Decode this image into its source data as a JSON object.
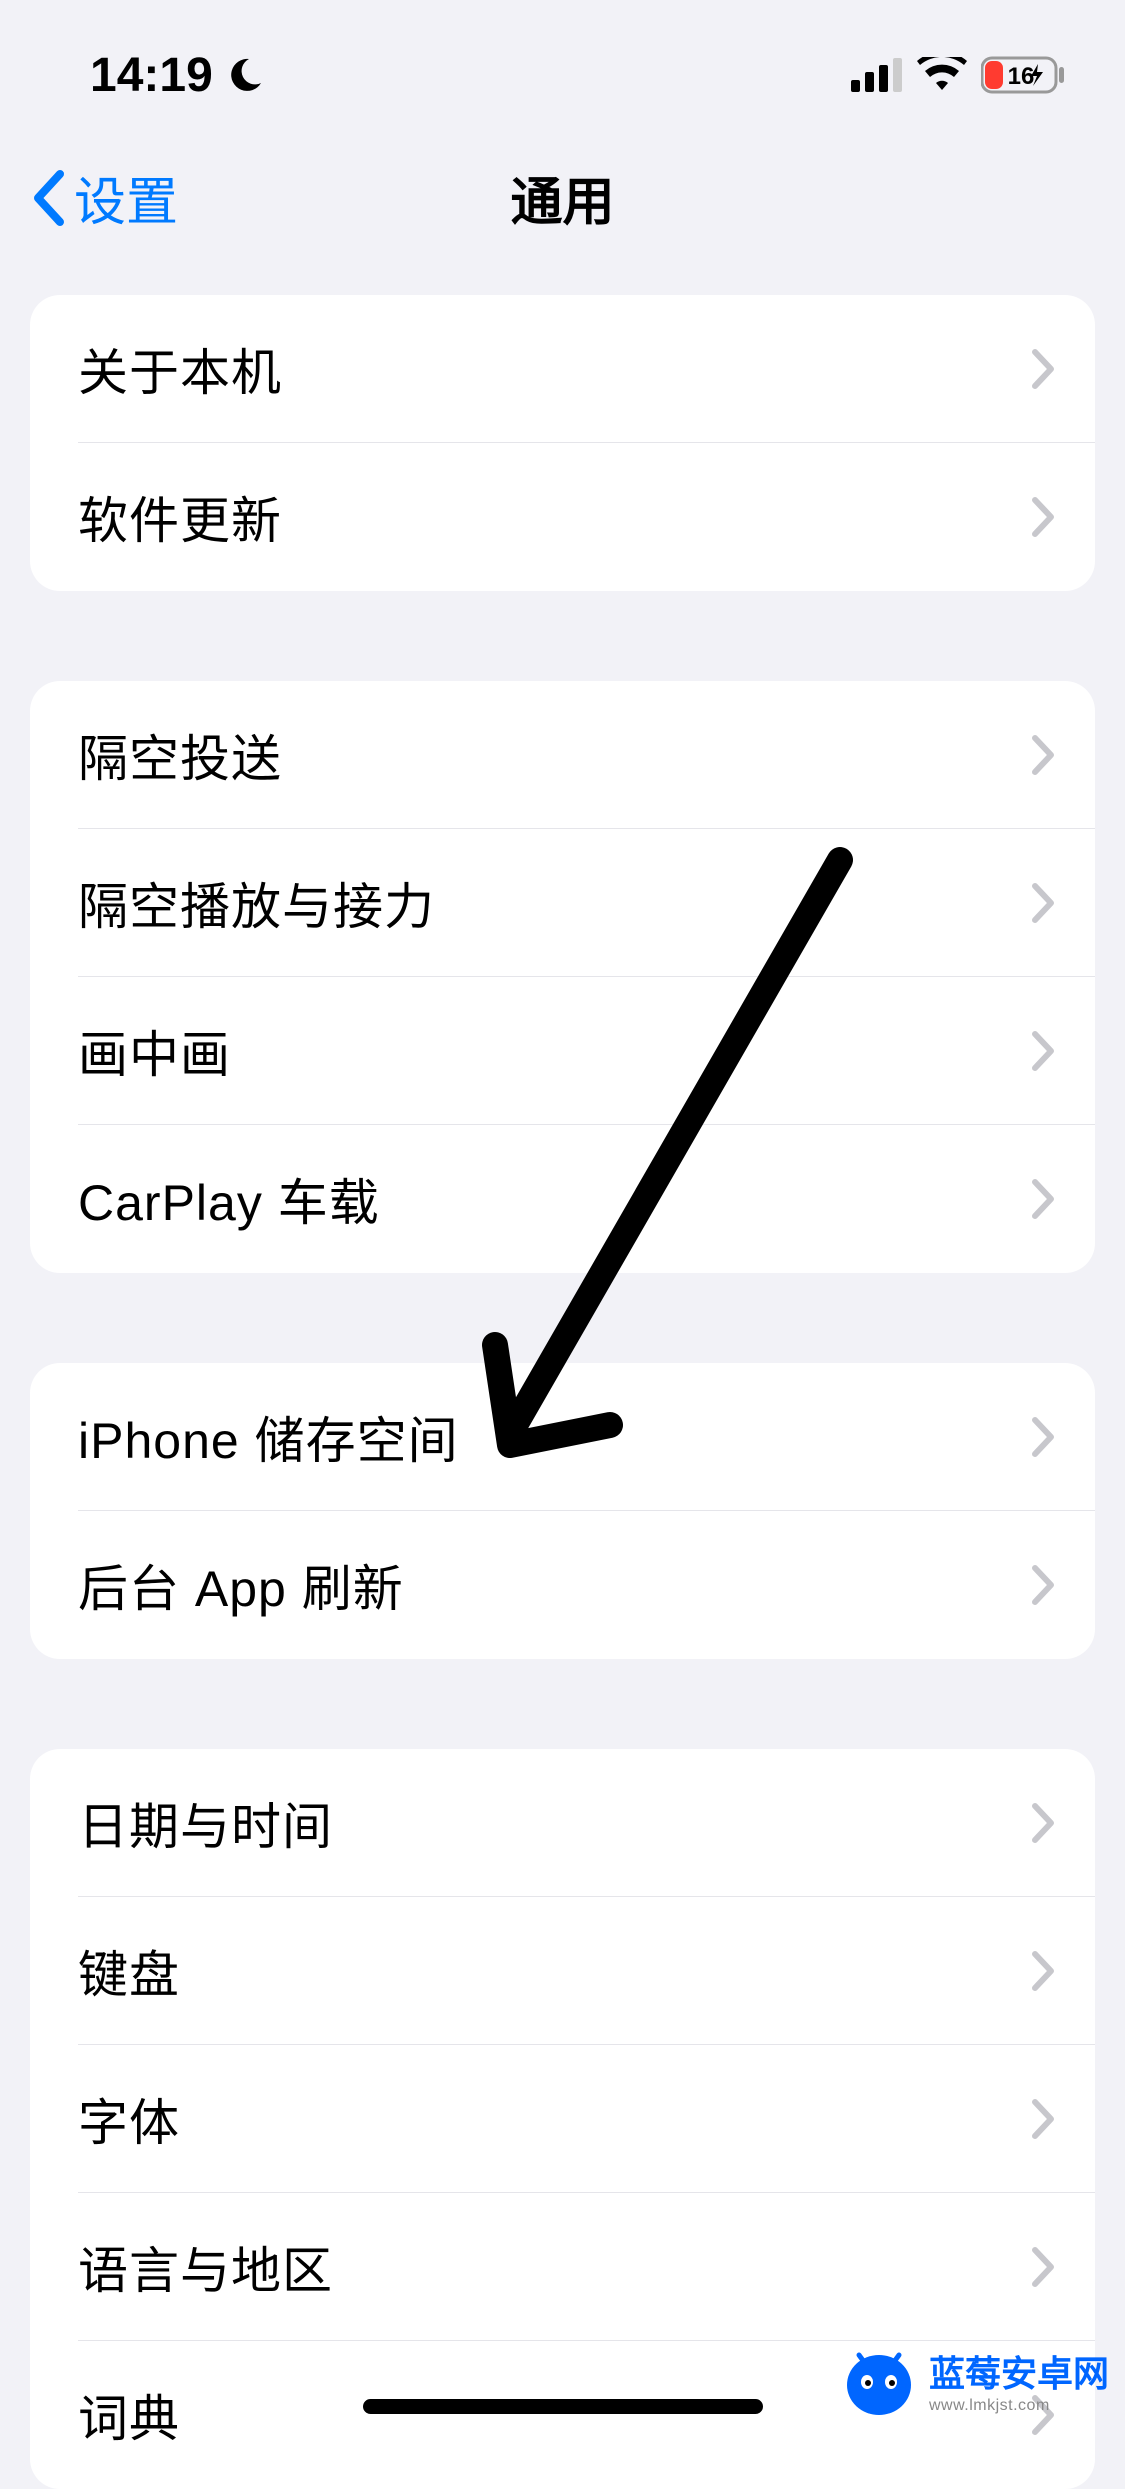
{
  "statusBar": {
    "time": "14:19",
    "batteryPercent": "16"
  },
  "nav": {
    "backLabel": "设置",
    "title": "通用"
  },
  "sections": [
    {
      "rows": [
        {
          "label": "关于本机"
        },
        {
          "label": "软件更新"
        }
      ]
    },
    {
      "rows": [
        {
          "label": "隔空投送"
        },
        {
          "label": "隔空播放与接力"
        },
        {
          "label": "画中画"
        },
        {
          "label": "CarPlay 车载"
        }
      ]
    },
    {
      "rows": [
        {
          "label": "iPhone 储存空间"
        },
        {
          "label": "后台 App 刷新"
        }
      ]
    },
    {
      "rows": [
        {
          "label": "日期与时间"
        },
        {
          "label": "键盘"
        },
        {
          "label": "字体"
        },
        {
          "label": "语言与地区"
        },
        {
          "label": "词典"
        }
      ]
    }
  ],
  "watermark": {
    "title": "蓝莓安卓网",
    "url": "www.lmkjst.com"
  }
}
